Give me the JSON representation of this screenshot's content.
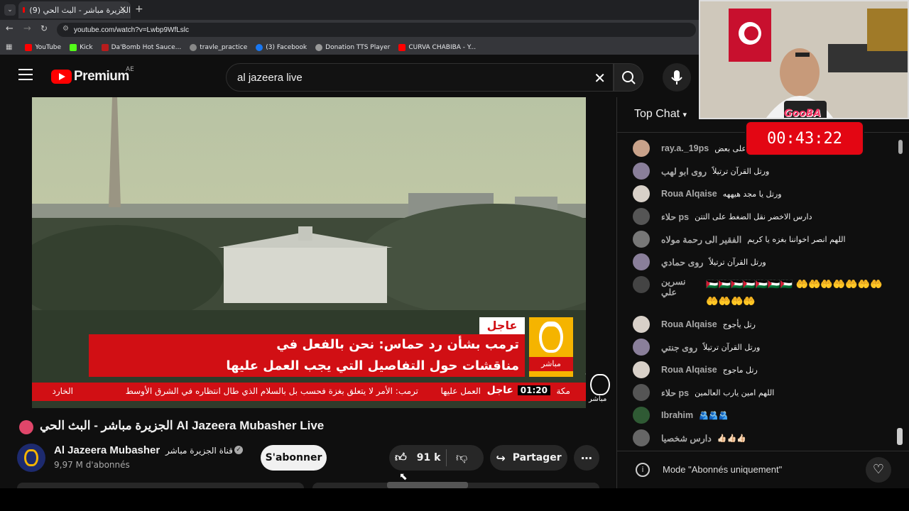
{
  "browser": {
    "tab_title": "الجزيرة مباشر - البث الحي (9)",
    "url": "youtube.com/watch?v=Lwbp9WfLslc",
    "bookmarks": [
      "YouTube",
      "Kick",
      "Da'Bomb Hot Sauce...",
      "travle_practice",
      "(3) Facebook",
      "Donation TTS Player",
      "CURVA CHABIBA - Y..."
    ]
  },
  "header": {
    "brand": "Premium",
    "region": "AE",
    "search_value": "al jazeera live"
  },
  "video": {
    "label_breaking": "عاجل",
    "headline_line1": "ترمب بشأن رد حماس: نحن بالفعل في",
    "headline_line2": "مناقشات حول التفاصيل التي يجب العمل عليها",
    "channel_logo_text": "مباشر",
    "ticker_time": "01:20",
    "ticker_city": "مكة",
    "ticker_label": "عاجل",
    "ticker_text": "ترمب: الأمر لا يتعلق بغزة فحسب بل بالسلام الذي طال انتظاره في الشرق الأوسط",
    "ticker_tail": "العمل عليها",
    "ticker_lead": "الخارد",
    "watermark": "مباشر"
  },
  "meta": {
    "title": "الجزيرة مباشر - البث الحي Al Jazeera Mubasher Live",
    "channel_name": "Al Jazeera Mubasher",
    "channel_name_ar": "قناة الجزيرة مباشر",
    "subscribers": "9,97 M d'abonnés",
    "subscribe_label": "S'abonner",
    "likes": "91 k",
    "share_label": "Partager"
  },
  "chat": {
    "mode_label": "Top Chat",
    "messages": [
      {
        "author": "ray.a._19ps",
        "text": "على بعض",
        "color": "#c9a28a"
      },
      {
        "author": "روى ابو لهب",
        "text": "ورتل القرآن ترتيلاً",
        "color": "#8a7f9a"
      },
      {
        "author": "Roua Alqaise",
        "text": "ورتل يا مجد هيههه",
        "color": "#d8d0c8"
      },
      {
        "author": "حلاء ps",
        "text": "دارس الاخضر نقل الضغط على التتن",
        "color": "#555"
      },
      {
        "author": "الفقير الى رحمة مولاه",
        "text": "اللهم انصر اخواننا بغزه يا كريم",
        "color": "#777"
      },
      {
        "author": "روى حمادي",
        "text": "ورتل القرآن ترتيلاً",
        "color": "#8a7f9a"
      },
      {
        "author": "نسرين علي",
        "text": "🇵🇸🇵🇸🇵🇸🇵🇸🇵🇸🇵🇸🇵🇸 🤲🤲🤲🤲🤲🤲🤲🤲🤲🤲🤲",
        "color": "#444"
      },
      {
        "author": "Roua Alqaise",
        "text": "رتل يأجوج",
        "color": "#d8d0c8"
      },
      {
        "author": "روى جنتي",
        "text": "ورتل القرآن ترتيلاً",
        "color": "#8a7f9a"
      },
      {
        "author": "Roua Alqaise",
        "text": "رتل ماجوج",
        "color": "#d8d0c8"
      },
      {
        "author": "حلاء ps",
        "text": "اللهم امين يارب العالمين",
        "color": "#555"
      },
      {
        "author": "Ibrahim",
        "text": "🫂🫂🫂",
        "color": "#2f5a34"
      },
      {
        "author": "دارس شخصيا",
        "text": "👍🏻👍🏻👍🏻",
        "color": "#666"
      }
    ],
    "footer": "Mode \"Abonnés uniquement\""
  },
  "overlay": {
    "timer": "00:43:22",
    "badge": "GooBA"
  },
  "colors": {
    "brand_red": "#ff0000",
    "aj_gold": "#f5b400",
    "ticker_red": "#d10f14"
  }
}
